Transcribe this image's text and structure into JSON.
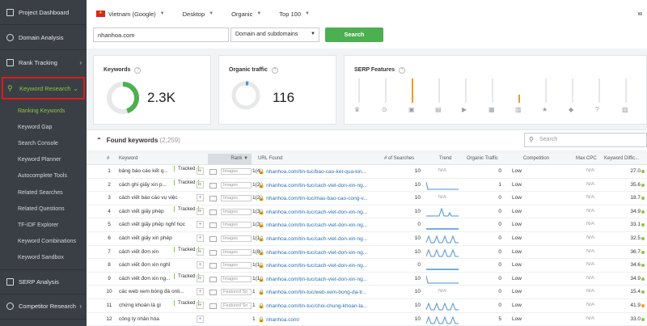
{
  "sidebar": {
    "items": [
      {
        "label": "Project Dashboard"
      },
      {
        "label": "Domain Analysis"
      },
      {
        "label": "Rank Tracking"
      },
      {
        "label": "Keyword Research"
      }
    ],
    "subitems": [
      "Ranking Keywords",
      "Keyword Gap",
      "Search Console",
      "Keyword Planner",
      "Autocomplete Tools",
      "Related Searches",
      "Related Questions",
      "TF-IDF Explorer",
      "Keyword Combinations",
      "Keyword Sandbox"
    ],
    "bottom": [
      {
        "label": "SERP Analysis"
      },
      {
        "label": "Competitor Research"
      }
    ]
  },
  "topbar": {
    "country": "Vietnam (Google)",
    "device": "Desktop",
    "type": "Organic",
    "top": "Top 100",
    "right": "w"
  },
  "search": {
    "domain": "nhanhoa.com",
    "scope": "Domain and subdomains",
    "button": "Search"
  },
  "cards": {
    "keywords": {
      "title": "Keywords",
      "value": "2.3K"
    },
    "traffic": {
      "title": "Organic traffic",
      "value": "116"
    },
    "serp": {
      "title": "SERP Features"
    }
  },
  "found": {
    "title": "Found keywords",
    "count": "(2,259)",
    "search_placeholder": "Search"
  },
  "table": {
    "headers": [
      "#",
      "Keyword",
      "Rank",
      "URL Found",
      "# of Searches",
      "Trend",
      "Organic Traffic",
      "Competition",
      "Max CPC",
      "Keyword Diffic..."
    ],
    "rows": [
      {
        "n": "1",
        "kw": "bảng báo cáo kết q...",
        "tracked": "Tracked",
        "feat": "Images",
        "rank": "1(4",
        "url": "nhanhoa.com/tin-tuc/bao-cao-ket-qua-kin...",
        "searches": "10",
        "trend": "N/A",
        "traffic": "0",
        "comp": "Low",
        "cpc": "N/A",
        "diff": "27.0",
        "dot": "#8ec63f"
      },
      {
        "n": "2",
        "kw": "cách ghi giấy xin p...",
        "tracked": "Tracked",
        "feat": "Images",
        "rank": "1(2",
        "url": "nhanhoa.com/tin-tuc/cach-viet-don-xin-ng...",
        "searches": "10",
        "trend": "line",
        "traffic": "1",
        "comp": "Low",
        "cpc": "N/A",
        "diff": "35.6",
        "dot": "#8ec63f"
      },
      {
        "n": "3",
        "kw": "cách viết báo cáo vụ việc",
        "tracked": "",
        "feat": "Images",
        "rank": "1(2",
        "url": "nhanhoa.com/tin-tuc/mau-bao-cao-cong-v...",
        "searches": "10",
        "trend": "N/A",
        "traffic": "0",
        "comp": "Low",
        "cpc": "N/A",
        "diff": "18.7",
        "dot": "#8ec63f"
      },
      {
        "n": "4",
        "kw": "cách viết giấy phép",
        "tracked": "Tracked",
        "feat": "Images",
        "rank": "1(3",
        "url": "nhanhoa.com/tin-tuc/cach-viet-don-xin-ng...",
        "searches": "10",
        "trend": "spike",
        "traffic": "0",
        "comp": "Low",
        "cpc": "N/A",
        "diff": "34.9",
        "dot": "#8ec63f"
      },
      {
        "n": "5",
        "kw": "cách viết giấy phép nghỉ học",
        "tracked": "",
        "feat": "Images",
        "rank": "1(3",
        "url": "nhanhoa.com/tin-tuc/cach-viet-don-xin-ng...",
        "searches": "0",
        "trend": "flat",
        "traffic": "0",
        "comp": "Low",
        "cpc": "N/A",
        "diff": "33.1",
        "dot": "#8ec63f"
      },
      {
        "n": "6",
        "kw": "cách viết giấy xin phép",
        "tracked": "",
        "feat": "Images",
        "rank": "1(1",
        "url": "nhanhoa.com/tin-tuc/cach-viet-don-xin-ng...",
        "searches": "10",
        "trend": "multi",
        "traffic": "0",
        "comp": "Low",
        "cpc": "N/A",
        "diff": "32.5",
        "dot": "#8ec63f"
      },
      {
        "n": "7",
        "kw": "cách viết đơn xin",
        "tracked": "Tracked",
        "feat": "Images",
        "rank": "1(8",
        "url": "nhanhoa.com/tin-tuc/cach-viet-don-xin-ng...",
        "searches": "10",
        "trend": "multi",
        "traffic": "0",
        "comp": "Low",
        "cpc": "N/A",
        "diff": "36.7",
        "dot": "#8ec63f"
      },
      {
        "n": "8",
        "kw": "cách viết đơn xin nghỉ",
        "tracked": "",
        "feat": "Images",
        "rank": "1(1",
        "url": "nhanhoa.com/tin-tuc/cach-viet-don-xin-ng...",
        "searches": "0",
        "trend": "flat",
        "traffic": "0",
        "comp": "Low",
        "cpc": "N/A",
        "diff": "34.6",
        "dot": "#8ec63f"
      },
      {
        "n": "9",
        "kw": "cách viết đơn xin ng...",
        "tracked": "Tracked",
        "feat": "Images",
        "rank": "1(1",
        "url": "nhanhoa.com/tin-tuc/cach-viet-don-xin-ng...",
        "searches": "10",
        "trend": "line",
        "traffic": "0",
        "comp": "Low",
        "cpc": "N/A",
        "diff": "34.9",
        "dot": "#8ec63f"
      },
      {
        "n": "10",
        "kw": "các web xem bóng đá onli...",
        "tracked": "",
        "feat": "Featured Sn",
        "rank": "1",
        "url": "nhanhoa.com/tin-tuc/web-xem-bong-da-tr...",
        "searches": "10",
        "trend": "N/A",
        "traffic": "0",
        "comp": "Low",
        "cpc": "N/A",
        "diff": "15.4",
        "dot": "#8ec63f"
      },
      {
        "n": "11",
        "kw": "chứng khoán là gì",
        "tracked": "Tracked",
        "feat": "Featured Sn",
        "rank": "1",
        "url": "nhanhoa.com/tin-tuc/choi-chung-khoan-la...",
        "searches": "10",
        "trend": "multi",
        "traffic": "0",
        "comp": "Low",
        "cpc": "N/A",
        "diff": "41.9",
        "dot": "#f29b1d"
      },
      {
        "n": "12",
        "kw": "công ty nhân hòa",
        "tracked": "",
        "feat": "",
        "rank": "1",
        "url": "nhanhoa.com/",
        "searches": "10",
        "trend": "multi",
        "traffic": "5",
        "comp": "Low",
        "cpc": "N/A",
        "diff": "33.0",
        "dot": "#8ec63f"
      }
    ]
  }
}
